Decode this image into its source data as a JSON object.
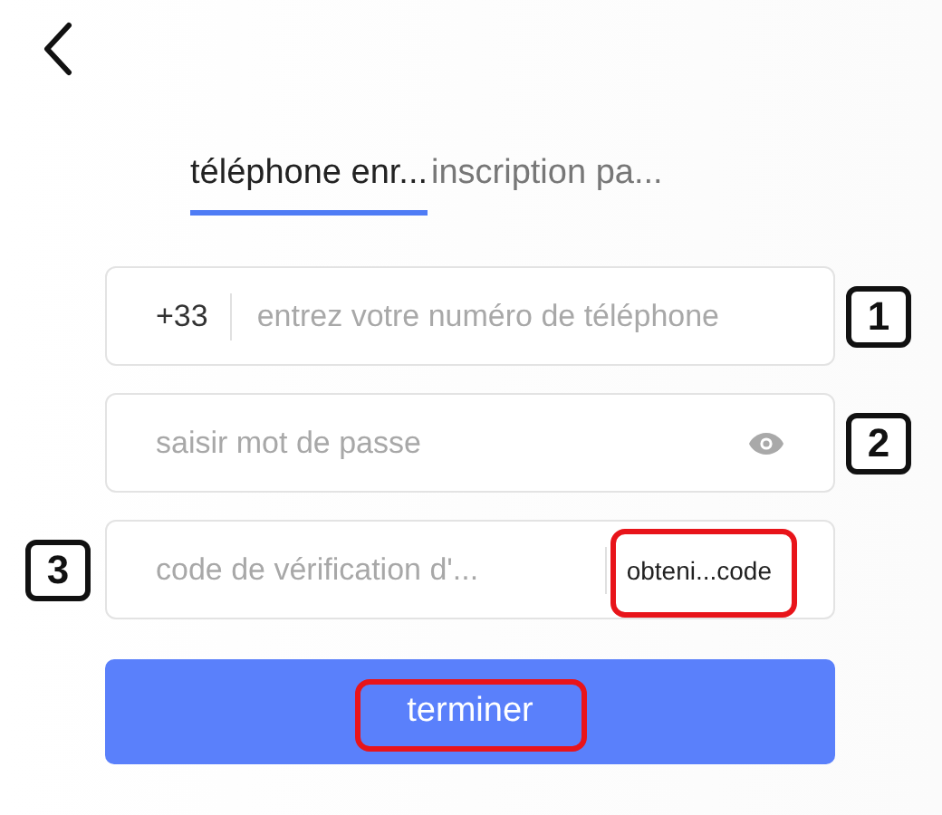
{
  "tabs": [
    {
      "label": "téléphone enr...",
      "selected": true
    },
    {
      "label": "inscription pa...",
      "selected": false
    }
  ],
  "fields": [
    {
      "kind": "phone",
      "prefix": "+33",
      "placeholder": "entrez votre numéro de téléphone",
      "callout": "1",
      "callout_on_left": false
    },
    {
      "kind": "password",
      "placeholder": "saisir mot de passe",
      "callout": "2",
      "callout_on_left": false
    },
    {
      "kind": "code",
      "placeholder": "code de vérification d'...",
      "action": "obteni...code",
      "action_highlighted": true,
      "callout": "3",
      "callout_on_left": true
    }
  ],
  "submit": {
    "label": "terminer",
    "highlighted": true
  }
}
